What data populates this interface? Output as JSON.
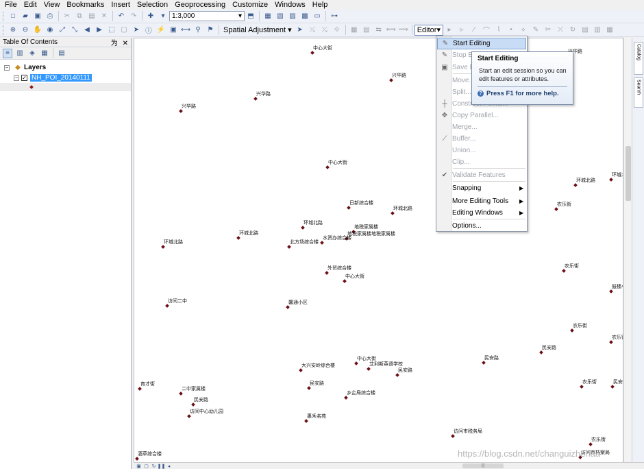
{
  "menu": [
    "File",
    "Edit",
    "View",
    "Bookmarks",
    "Insert",
    "Selection",
    "Geoprocessing",
    "Customize",
    "Windows",
    "Help"
  ],
  "toolbar": {
    "scale": "1:3,000",
    "spatial_adjustment": "Spatial Adjustment",
    "editor": "Editor"
  },
  "toc": {
    "title": "Table Of Contents",
    "pin": "为",
    "close": "✕",
    "layers_label": "Layers",
    "layer_name": "NH_POI_20140111"
  },
  "editor_menu": {
    "items": [
      {
        "label": "Start Editing",
        "icon": "pencil-icon",
        "state": "highlighted"
      },
      {
        "label": "Stop Editing",
        "icon": "stop-icon",
        "state": "disabled"
      },
      {
        "label": "Save Edits",
        "icon": "save-icon",
        "state": "disabled"
      },
      {
        "label": "Move...",
        "icon": "",
        "state": "disabled"
      },
      {
        "label": "Split...",
        "icon": "",
        "state": "disabled"
      },
      {
        "label": "Construct Points...",
        "icon": "construct-icon",
        "state": "disabled"
      },
      {
        "label": "Copy Parallel...",
        "icon": "copy-parallel-icon",
        "state": "disabled"
      },
      {
        "label": "Merge...",
        "icon": "",
        "state": "disabled"
      },
      {
        "label": "Buffer...",
        "icon": "buffer-icon",
        "state": "disabled"
      },
      {
        "label": "Union...",
        "icon": "",
        "state": "disabled"
      },
      {
        "label": "Clip...",
        "icon": "",
        "state": "disabled"
      },
      {
        "label": "Validate Features",
        "icon": "validate-icon",
        "state": "disabled"
      },
      {
        "label": "Snapping",
        "icon": "",
        "state": "submenu"
      },
      {
        "label": "More Editing Tools",
        "icon": "",
        "state": "submenu"
      },
      {
        "label": "Editing Windows",
        "icon": "",
        "state": "submenu"
      },
      {
        "label": "Options...",
        "icon": "",
        "state": "normal"
      }
    ]
  },
  "tooltip": {
    "title": "Start Editing",
    "body": "Start an edit session so you can edit features or attributes.",
    "help": "Press F1 for more help."
  },
  "right_tabs": [
    "Catalog",
    "Search"
  ],
  "watermark": "https://blog.csdn.net/changuizhenaa",
  "map_labels": [
    "中心大街",
    "兴华路",
    "兴华路",
    "兴华路",
    "兴华路",
    "兴华路",
    "中心大街",
    "环城北路",
    "环城北路",
    "农乐街",
    "日新综合楼",
    "环城北路",
    "环城北路",
    "环城北路",
    "地税家属楼",
    "地税家属楼地税家属楼",
    "北方场综合楼",
    "水资办综合楼",
    "环城北路",
    "外贸综合楼",
    "中心大街",
    "农乐街",
    "鼓楼小学",
    "访间二中",
    "馨通小区",
    "农乐街",
    "农乐街",
    "民安路",
    "民安路",
    "中心大街",
    "艾利斯英语学校",
    "大兴安岭综合楼",
    "民安路",
    "民安路",
    "育才街",
    "二中家属楼",
    "民安路",
    "乡企局综合楼",
    "农乐街",
    "民安路",
    "访间中心幼儿园",
    "惠禾名苑",
    "访问市税务局",
    "农乐街",
    "酒草综合楼",
    "访问市档案局"
  ]
}
